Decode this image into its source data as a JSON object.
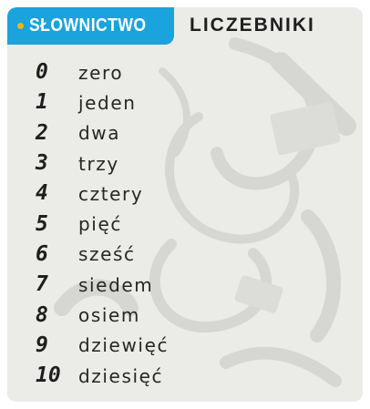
{
  "section_tag": "SŁOWNICTWO",
  "heading": "LICZEBNIKI",
  "colors": {
    "tag_background": "#1aa3dc",
    "tag_dot": "#f5b400",
    "card_background": "#ebebe8",
    "text": "#1e1e1e"
  },
  "numbers": [
    {
      "numeral": "0",
      "word": "zero"
    },
    {
      "numeral": "1",
      "word": "jeden"
    },
    {
      "numeral": "2",
      "word": "dwa"
    },
    {
      "numeral": "3",
      "word": "trzy"
    },
    {
      "numeral": "4",
      "word": "cztery"
    },
    {
      "numeral": "5",
      "word": "pięć"
    },
    {
      "numeral": "6",
      "word": "sześć"
    },
    {
      "numeral": "7",
      "word": "siedem"
    },
    {
      "numeral": "8",
      "word": "osiem"
    },
    {
      "numeral": "9",
      "word": "dziewięć"
    },
    {
      "numeral": "10",
      "word": "dziesięć"
    }
  ]
}
